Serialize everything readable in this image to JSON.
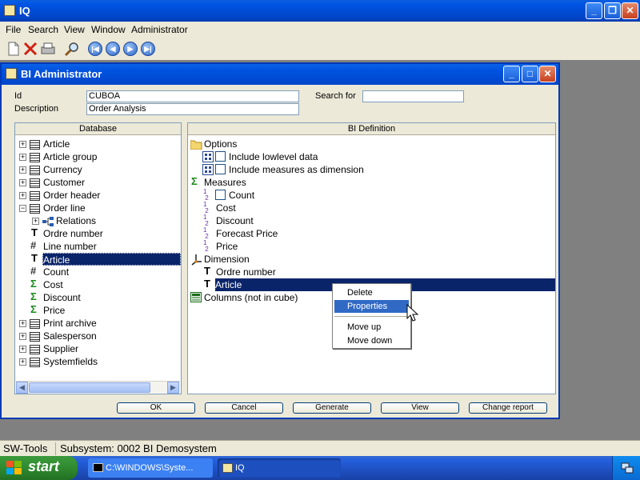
{
  "app": {
    "title": "IQ"
  },
  "menubar": [
    "File",
    "Search",
    "View",
    "Window",
    "Administrator"
  ],
  "frame": {
    "title": "BI Administrator",
    "id_label": "Id",
    "id_value": "CUBOA",
    "description_label": "Description",
    "description_value": "Order Analysis",
    "search_label": "Search for",
    "search_value": ""
  },
  "database": {
    "header": "Database",
    "items": [
      {
        "label": "Article",
        "icon": "table-icon",
        "expander": "+"
      },
      {
        "label": "Article group",
        "icon": "table-icon",
        "expander": "+"
      },
      {
        "label": "Currency",
        "icon": "table-icon",
        "expander": "+"
      },
      {
        "label": "Customer",
        "icon": "table-icon",
        "expander": "+"
      },
      {
        "label": "Order header",
        "icon": "table-icon",
        "expander": "+"
      },
      {
        "label": "Order line",
        "icon": "table-icon",
        "expander": "−"
      },
      {
        "label": "Relations",
        "icon": "relations-icon",
        "expander": "+"
      },
      {
        "label": "Ordre number",
        "icon": "text-field-icon"
      },
      {
        "label": "Line number",
        "icon": "number-field-icon"
      },
      {
        "label": "Article",
        "icon": "text-field-icon",
        "selected": true
      },
      {
        "label": "Count",
        "icon": "number-field-icon"
      },
      {
        "label": "Cost",
        "icon": "sum-icon"
      },
      {
        "label": "Discount",
        "icon": "sum-icon"
      },
      {
        "label": "Price",
        "icon": "sum-icon"
      },
      {
        "label": "Print archive",
        "icon": "table-icon",
        "expander": "+"
      },
      {
        "label": "Salesperson",
        "icon": "table-icon",
        "expander": "+"
      },
      {
        "label": "Supplier",
        "icon": "table-icon",
        "expander": "+"
      },
      {
        "label": "Systemfields",
        "icon": "table-icon",
        "expander": "+"
      }
    ]
  },
  "definition": {
    "header": "BI Definition",
    "items": [
      {
        "label": "Options",
        "icon": "folder-icon"
      },
      {
        "label": "Include lowlevel data",
        "icon": "option-icon",
        "checkbox": true
      },
      {
        "label": "Include measures as dimension",
        "icon": "option-icon",
        "checkbox": true
      },
      {
        "label": "Measures",
        "icon": "sum-icon"
      },
      {
        "label": "Count",
        "icon": "measure-icon",
        "checkbox": true
      },
      {
        "label": "Cost",
        "icon": "measure-icon"
      },
      {
        "label": "Discount",
        "icon": "measure-icon"
      },
      {
        "label": "Forecast Price",
        "icon": "measure-icon"
      },
      {
        "label": "Price",
        "icon": "measure-icon"
      },
      {
        "label": "Dimension",
        "icon": "axis-icon"
      },
      {
        "label": "Ordre number",
        "icon": "text-field-icon"
      },
      {
        "label": "Article",
        "icon": "text-field-icon",
        "selected": true
      },
      {
        "label": "Columns (not in cube)",
        "icon": "columns-icon"
      }
    ]
  },
  "buttons": [
    "OK",
    "Cancel",
    "Generate",
    "View",
    "Change report"
  ],
  "context_menu": [
    "Delete",
    "Properties",
    "Move up",
    "Move down"
  ],
  "status": {
    "left": "SW-Tools",
    "right": "Subsystem: 0002 BI Demosystem"
  },
  "taskbar": {
    "start": "start",
    "tasks": [
      "C:\\WINDOWS\\Syste...",
      "IQ"
    ]
  }
}
